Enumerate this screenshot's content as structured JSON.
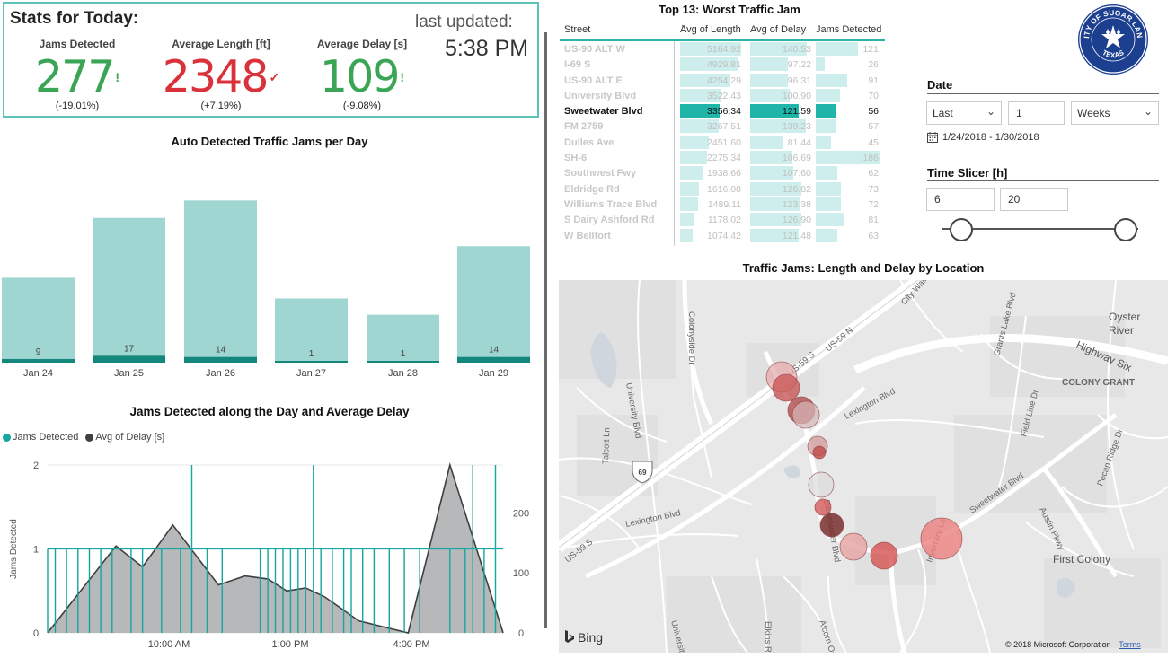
{
  "kpis": {
    "title": "Stats for Today:",
    "jams": {
      "label": "Jams Detected",
      "value": "277",
      "mark": "!",
      "change": "(-19.01%)",
      "color": "#3aa655"
    },
    "length": {
      "label": "Average Length [ft]",
      "value": "2348",
      "mark": "✓",
      "change": "(+7.19%)",
      "color": "#d9323a"
    },
    "delay": {
      "label": "Average Delay [s]",
      "value": "109",
      "mark": "!",
      "change": "(-9.08%)",
      "color": "#3aa655"
    },
    "last_updated_label": "last updated:",
    "last_updated_time": "5:38 PM"
  },
  "chart1": {
    "title": "Auto Detected Traffic Jams per Day"
  },
  "chart2": {
    "title": "Jams Detected along the Day and Average Delay",
    "legend": [
      {
        "name": "Jams Detected",
        "color": "#14a6a0"
      },
      {
        "name": "Avg of Delay [s]",
        "color": "#404040"
      }
    ]
  },
  "chart_data": [
    {
      "type": "bar",
      "title": "Auto Detected Traffic Jams per Day",
      "categories": [
        "Jan 24",
        "Jan 25",
        "Jan 26",
        "Jan 27",
        "Jan 28",
        "Jan 29"
      ],
      "series": [
        {
          "values": [
            78,
            133,
            149,
            59,
            44,
            107
          ]
        },
        {
          "values": [
            9,
            17,
            14,
            1,
            1,
            14
          ]
        }
      ],
      "data_labels": [
        "9",
        "17",
        "14",
        "1",
        "1",
        "14"
      ],
      "colors": {
        "bar": "#a0d6d1",
        "segment": "#14877d"
      },
      "ylim": [
        0,
        160
      ]
    },
    {
      "type": "area",
      "title": "Jams Detected along the Day and Average Delay",
      "xlabel": "",
      "ylabel": "Jams Detected",
      "x_ticks": [
        "10:00 AM",
        "1:00 PM",
        "4:00 PM"
      ],
      "y_left_ticks": [
        "0",
        "1",
        "2"
      ],
      "y_right_ticks": [
        "0",
        "100",
        "200"
      ],
      "y_left_lim": [
        0,
        2
      ],
      "y_right_lim": [
        0,
        280
      ],
      "series": [
        {
          "name": "Avg of Delay [s]",
          "points": [
            [
              0,
              0
            ],
            [
              1.8,
              145
            ],
            [
              2.5,
              110
            ],
            [
              3.3,
              180
            ],
            [
              4.5,
              80
            ],
            [
              5.2,
              95
            ],
            [
              5.8,
              90
            ],
            [
              6.3,
              70
            ],
            [
              6.8,
              75
            ],
            [
              7.3,
              60
            ],
            [
              8.2,
              20
            ],
            [
              9.5,
              0
            ],
            [
              10.6,
              280
            ],
            [
              12.0,
              0
            ]
          ]
        },
        {
          "name": "Jams Detected",
          "points": [
            [
              0.0,
              1
            ],
            [
              0.2,
              1
            ],
            [
              0.5,
              1
            ],
            [
              0.8,
              1
            ],
            [
              1.1,
              1
            ],
            [
              1.4,
              1
            ],
            [
              1.7,
              1
            ],
            [
              2.2,
              1
            ],
            [
              2.5,
              1
            ],
            [
              3.0,
              1
            ],
            [
              3.5,
              1
            ],
            [
              3.8,
              2
            ],
            [
              4.2,
              1
            ],
            [
              4.6,
              1
            ],
            [
              5.6,
              1
            ],
            [
              5.8,
              1
            ],
            [
              6.0,
              1
            ],
            [
              6.2,
              1
            ],
            [
              6.4,
              1
            ],
            [
              6.6,
              1
            ],
            [
              6.8,
              1
            ],
            [
              7.0,
              2
            ],
            [
              7.2,
              1
            ],
            [
              7.5,
              1
            ],
            [
              7.8,
              1
            ],
            [
              8.0,
              1
            ],
            [
              8.3,
              1
            ],
            [
              8.6,
              1
            ],
            [
              9.0,
              1
            ],
            [
              9.4,
              1
            ],
            [
              9.8,
              1
            ],
            [
              10.6,
              1
            ],
            [
              11.0,
              1
            ],
            [
              11.2,
              2
            ],
            [
              11.5,
              1
            ],
            [
              11.8,
              2
            ]
          ]
        }
      ]
    },
    {
      "type": "table",
      "title": "Top 13: Worst Traffic Jam",
      "columns": [
        "Street",
        "Avg of Length",
        "Avg of Delay",
        "Jams Detected"
      ],
      "rows": [
        {
          "street": "US-90 ALT W",
          "length": "5164.92",
          "delay": "140.53",
          "jams": "121",
          "lf": 0.97,
          "df": 0.9,
          "jf": 0.65
        },
        {
          "street": "I-69 S",
          "length": "4929.81",
          "delay": "97.22",
          "jams": "26",
          "lf": 0.92,
          "df": 0.6,
          "jf": 0.14
        },
        {
          "street": "US-90 ALT E",
          "length": "4254.29",
          "delay": "96.31",
          "jams": "91",
          "lf": 0.8,
          "df": 0.6,
          "jf": 0.49
        },
        {
          "street": "University Blvd",
          "length": "3522.43",
          "delay": "100.90",
          "jams": "70",
          "lf": 0.66,
          "df": 0.63,
          "jf": 0.38
        },
        {
          "street": "Sweetwater Blvd",
          "length": "3356.34",
          "delay": "121.59",
          "jams": "56",
          "lf": 0.63,
          "df": 0.77,
          "jf": 0.3
        },
        {
          "street": "FM 2759",
          "length": "3267.51",
          "delay": "139.23",
          "jams": "57",
          "lf": 0.61,
          "df": 0.89,
          "jf": 0.31
        },
        {
          "street": "Dulles Ave",
          "length": "2451.60",
          "delay": "81.44",
          "jams": "45",
          "lf": 0.46,
          "df": 0.51,
          "jf": 0.24
        },
        {
          "street": "SH-6",
          "length": "2275.34",
          "delay": "106.69",
          "jams": "186",
          "lf": 0.43,
          "df": 0.67,
          "jf": 1.0
        },
        {
          "street": "Southwest Fwy",
          "length": "1938.66",
          "delay": "107.60",
          "jams": "62",
          "lf": 0.36,
          "df": 0.68,
          "jf": 0.33
        },
        {
          "street": "Eldridge Rd",
          "length": "1616.08",
          "delay": "126.82",
          "jams": "73",
          "lf": 0.3,
          "df": 0.81,
          "jf": 0.39
        },
        {
          "street": "Williams Trace Blvd",
          "length": "1489.11",
          "delay": "123.38",
          "jams": "72",
          "lf": 0.28,
          "df": 0.78,
          "jf": 0.39
        },
        {
          "street": "S Dairy Ashford Rd",
          "length": "1178.02",
          "delay": "126.90",
          "jams": "81",
          "lf": 0.22,
          "df": 0.81,
          "jf": 0.44
        },
        {
          "street": "W Bellfort",
          "length": "1074.42",
          "delay": "121.48",
          "jams": "63",
          "lf": 0.2,
          "df": 0.77,
          "jf": 0.34
        }
      ],
      "selected_row": "Sweetwater Blvd"
    }
  ],
  "logo": {
    "top_text": "CITY OF SUGAR LAND",
    "bottom_text": "TEXAS"
  },
  "slicers": {
    "date": {
      "title": "Date",
      "mode": "Last",
      "count": "1",
      "unit": "Weeks",
      "range": "1/24/2018 - 1/30/2018"
    },
    "time": {
      "title": "Time Slicer [h]",
      "start": "6",
      "end": "20"
    }
  },
  "map": {
    "title": "Traffic Jams: Length and Delay by Location",
    "labels": [
      {
        "text": "US-59 S",
        "rot": -40
      },
      {
        "text": "US-59 N",
        "rot": -40
      },
      {
        "text": "City Walk",
        "rot": -48
      },
      {
        "text": "Highway Six",
        "rot": 24
      },
      {
        "text": "Oyster",
        "rot": 0
      },
      {
        "text": "River",
        "rot": 0
      },
      {
        "text": "Colonyside Dr",
        "rot": 90
      },
      {
        "text": "University Blvd",
        "rot": 80
      },
      {
        "text": "Grants Lake Blvd",
        "rot": -75
      },
      {
        "text": "COLONY GRANT",
        "rot": 0
      },
      {
        "text": "Talcott Ln",
        "rot": -88
      },
      {
        "text": "Lexington Blvd",
        "rot": -28
      },
      {
        "text": "Field Line Dr",
        "rot": -75
      },
      {
        "text": "Pecan Ridge Dr",
        "rot": -70
      },
      {
        "text": "Lexington Blvd",
        "rot": -12
      },
      {
        "text": "Sweetwater Blvd",
        "rot": -35
      },
      {
        "text": "Austin Pkwy",
        "rot": 64
      },
      {
        "text": "US-59 S",
        "rot": -38
      },
      {
        "text": "First Colony",
        "rot": 0
      },
      {
        "text": "Inverrary Ln",
        "rot": -72
      },
      {
        "text": "Elkins Rd",
        "rot": 90
      },
      {
        "text": "Alcorn Oaks Dr",
        "rot": 72
      },
      {
        "text": "University Blvd",
        "rot": 75
      },
      {
        "text": "Sweetwater Blvd",
        "rot": 80
      }
    ],
    "bing": "Bing",
    "copyright": "© 2018 Microsoft Corporation",
    "terms": "Terms",
    "shield": "69"
  },
  "colors": {
    "teal": "#14a6a0",
    "light_teal": "#a0d6d1",
    "frame": "#5cc1b6",
    "bubble": "#e06060"
  }
}
